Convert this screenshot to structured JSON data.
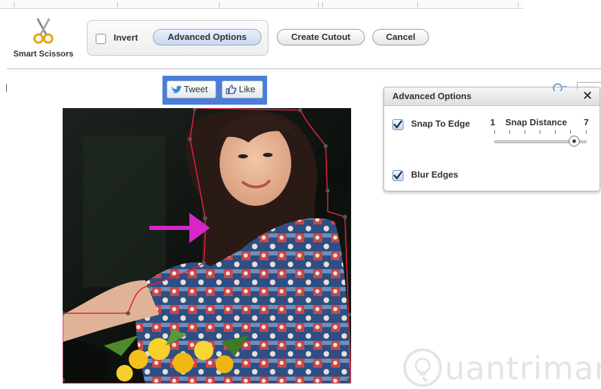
{
  "toolbar": {
    "tool_label": "Smart Scissors",
    "invert_label": "Invert",
    "advanced_label": "Advanced Options",
    "create_cutout_label": "Create Cutout",
    "cancel_label": "Cancel"
  },
  "social": {
    "tweet_label": "Tweet",
    "like_label": "Like"
  },
  "panel": {
    "title": "Advanced Options",
    "close_glyph": "✕",
    "snap_to_edge_label": "Snap To Edge",
    "snap_to_edge_checked": true,
    "snap_distance_label": "Snap Distance",
    "snap_distance_min": "1",
    "snap_distance_max": "7",
    "snap_distance_value": 6.2,
    "blur_edges_label": "Blur Edges",
    "blur_edges_checked": true
  },
  "icons": {
    "tool": "scissors-icon",
    "twitter": "twitter-bird-icon",
    "like": "thumbs-up-icon",
    "arrow": "arrow-right-icon",
    "watermark": "lightbulb-icon"
  },
  "colors": {
    "accent_blue": "#4a7ed8",
    "cutout_line": "#e0203a",
    "arrow": "#d626c8",
    "watermark": "#e4e4e4"
  },
  "watermark": {
    "text": "uantrimang"
  }
}
